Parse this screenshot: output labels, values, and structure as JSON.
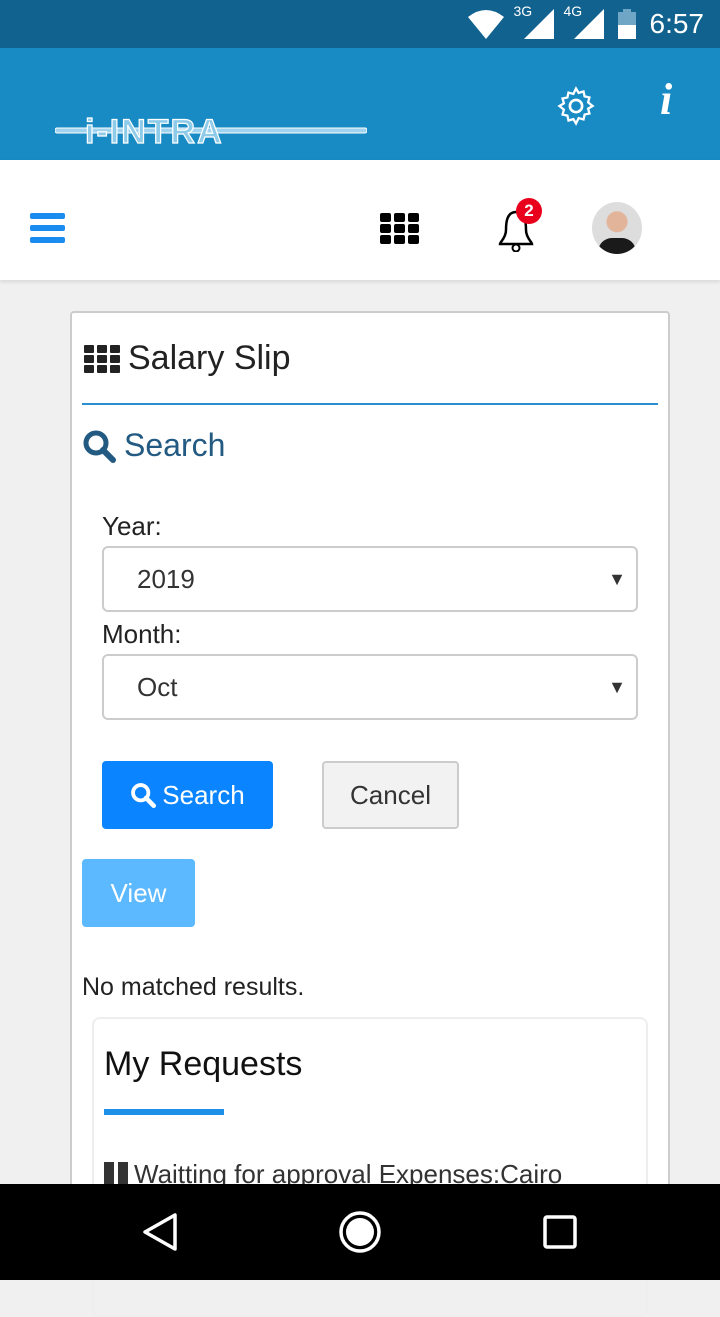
{
  "status": {
    "time": "6:57",
    "net1": "3G",
    "net2": "4G"
  },
  "header": {
    "logo": "i-INTRA",
    "notification_count": "2"
  },
  "page": {
    "title": "Salary Slip",
    "search_heading": "Search",
    "year_label": "Year:",
    "year_value": "2019",
    "month_label": "Month:",
    "month_value": "Oct",
    "search_button": "Search",
    "cancel_button": "Cancel",
    "view_button": "View",
    "no_results": "No matched results."
  },
  "requests": {
    "title": "My Requests",
    "items": [
      {
        "text": "Waitting for approval Expenses:Cairo"
      }
    ]
  },
  "colors": {
    "statusbar": "#12628f",
    "appbar": "#188ac4",
    "primary": "#0a84ff",
    "view": "#5cb8ff",
    "badge": "#e8001c"
  }
}
